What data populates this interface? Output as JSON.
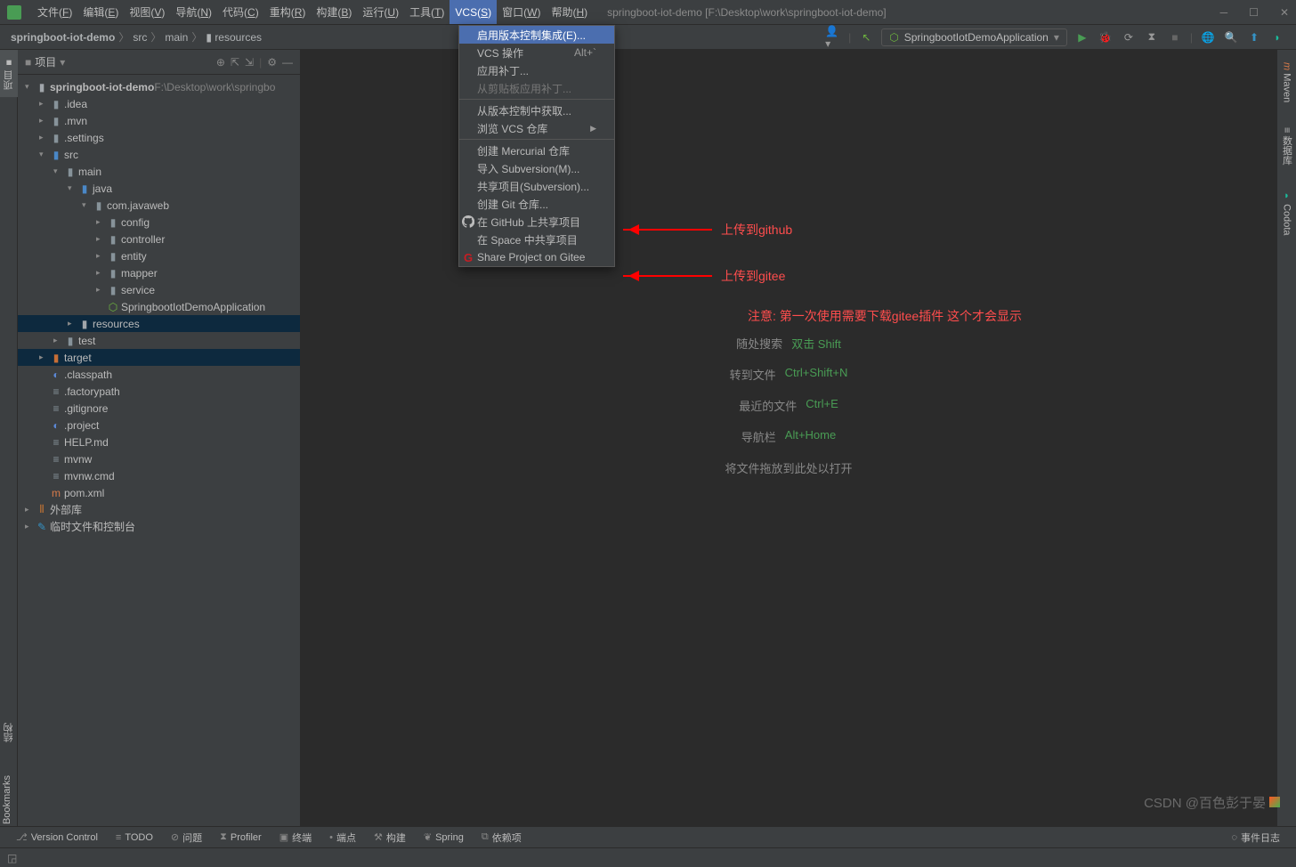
{
  "titlebar": {
    "menus": [
      "文件(F)",
      "编辑(E)",
      "视图(V)",
      "导航(N)",
      "代码(C)",
      "重构(R)",
      "构建(B)",
      "运行(U)",
      "工具(T)",
      "VCS(S)",
      "窗口(W)",
      "帮助(H)"
    ],
    "window_title": "springboot-iot-demo [F:\\Desktop\\work\\springboot-iot-demo]"
  },
  "breadcrumbs": [
    "springboot-iot-demo",
    "src",
    "main",
    "resources"
  ],
  "run_config": "SpringbootIotDemoApplication",
  "sidebar": {
    "title": "项目"
  },
  "tree": [
    {
      "d": 0,
      "exp": true,
      "icon": "project",
      "label": "springboot-iot-demo",
      "path": "  F:\\Desktop\\work\\springbo",
      "bold": true
    },
    {
      "d": 1,
      "exp": false,
      "icon": "folder",
      "label": ".idea"
    },
    {
      "d": 1,
      "exp": false,
      "icon": "folder",
      "label": ".mvn"
    },
    {
      "d": 1,
      "exp": false,
      "icon": "folder",
      "label": ".settings"
    },
    {
      "d": 1,
      "exp": true,
      "icon": "folder-src",
      "label": "src"
    },
    {
      "d": 2,
      "exp": true,
      "icon": "folder",
      "label": "main"
    },
    {
      "d": 3,
      "exp": true,
      "icon": "folder-blue",
      "label": "java"
    },
    {
      "d": 4,
      "exp": true,
      "icon": "folder",
      "label": "com.javaweb"
    },
    {
      "d": 5,
      "exp": false,
      "icon": "folder",
      "label": "config"
    },
    {
      "d": 5,
      "exp": false,
      "icon": "folder",
      "label": "controller"
    },
    {
      "d": 5,
      "exp": false,
      "icon": "folder",
      "label": "entity"
    },
    {
      "d": 5,
      "exp": false,
      "icon": "folder",
      "label": "mapper"
    },
    {
      "d": 5,
      "exp": false,
      "icon": "folder",
      "label": "service"
    },
    {
      "d": 5,
      "leaf": true,
      "icon": "spring",
      "label": "SpringbootIotDemoApplication"
    },
    {
      "d": 3,
      "exp": false,
      "icon": "folder-res",
      "label": "resources",
      "sel": true
    },
    {
      "d": 2,
      "exp": false,
      "icon": "folder",
      "label": "test"
    },
    {
      "d": 1,
      "exp": false,
      "icon": "folder-target",
      "label": "target",
      "sel": true
    },
    {
      "d": 1,
      "leaf": true,
      "icon": "ecl",
      "label": ".classpath"
    },
    {
      "d": 1,
      "leaf": true,
      "icon": "file",
      "label": ".factorypath"
    },
    {
      "d": 1,
      "leaf": true,
      "icon": "file",
      "label": ".gitignore"
    },
    {
      "d": 1,
      "leaf": true,
      "icon": "ecl",
      "label": ".project"
    },
    {
      "d": 1,
      "leaf": true,
      "icon": "md",
      "label": "HELP.md"
    },
    {
      "d": 1,
      "leaf": true,
      "icon": "file",
      "label": "mvnw"
    },
    {
      "d": 1,
      "leaf": true,
      "icon": "cmd",
      "label": "mvnw.cmd"
    },
    {
      "d": 1,
      "leaf": true,
      "icon": "maven",
      "label": "pom.xml"
    },
    {
      "d": 0,
      "exp": false,
      "icon": "lib",
      "label": "外部库"
    },
    {
      "d": 0,
      "exp": false,
      "icon": "scratch",
      "label": "临时文件和控制台"
    }
  ],
  "dropdown": [
    {
      "label": "启用版本控制集成(E)...",
      "hl": true
    },
    {
      "label": "VCS 操作",
      "shortcut": "Alt+`"
    },
    {
      "label": "应用补丁..."
    },
    {
      "label": "从剪贴板应用补丁...",
      "disabled": true
    },
    {
      "sep": true
    },
    {
      "label": "从版本控制中获取..."
    },
    {
      "label": "浏览 VCS 仓库",
      "arrow": true
    },
    {
      "sep": true
    },
    {
      "label": "创建 Mercurial 仓库"
    },
    {
      "label": "导入 Subversion(M)..."
    },
    {
      "label": "共享项目(Subversion)..."
    },
    {
      "label": "创建 Git 仓库..."
    },
    {
      "label": "在 GitHub 上共享项目",
      "icon": "github"
    },
    {
      "label": "在 Space 中共享项目"
    },
    {
      "label": "Share Project on Gitee",
      "icon": "gitee"
    }
  ],
  "empty_hints": [
    {
      "label": "随处搜索",
      "shortcut": "双击 Shift"
    },
    {
      "label": "转到文件",
      "shortcut": "Ctrl+Shift+N"
    },
    {
      "label": "最近的文件",
      "shortcut": "Ctrl+E"
    },
    {
      "label": "导航栏",
      "shortcut": "Alt+Home"
    },
    {
      "label": "将文件拖放到此处以打开",
      "shortcut": ""
    }
  ],
  "annotations": {
    "github": "上传到github",
    "gitee": "上传到gitee",
    "note": "注意: 第一次使用需要下载gitee插件  这个才会显示"
  },
  "statusbar": {
    "items": [
      "Version Control",
      "TODO",
      "问题",
      "Profiler",
      "终端",
      "端点",
      "构建",
      "Spring",
      "依赖项"
    ],
    "right": "事件日志"
  },
  "left_gutter": {
    "project": "项目",
    "structure": "结构",
    "bookmarks": "Bookmarks"
  },
  "right_gutter": {
    "maven": "Maven",
    "db": "数据库",
    "codota": "Codota"
  },
  "watermark": "CSDN @百色彭于晏"
}
